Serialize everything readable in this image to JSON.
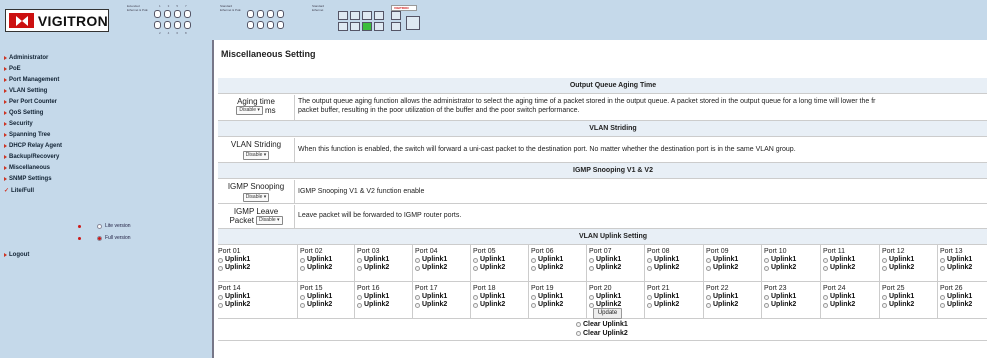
{
  "brand": {
    "name": "VIGITRON",
    "mini_logo": "VIGITRON",
    "accent": "#cc1010",
    "header_bg": "#c5d9ea"
  },
  "panel": {
    "group1_label": "Extended Ethernet & PoE",
    "group2_label": "Standard Ethernet & PoE",
    "group3_label": "Standard Ethernet",
    "group1_top_nums": [
      "1",
      "3",
      "5",
      "7"
    ],
    "group1_bottom_nums": [
      "2",
      "4",
      "6",
      "8"
    ],
    "uplink_label": "Uplink"
  },
  "sidebar": {
    "items": [
      {
        "label": "Administrator"
      },
      {
        "label": "PoE"
      },
      {
        "label": "Port Management"
      },
      {
        "label": "VLAN Setting"
      },
      {
        "label": "Per Port Counter"
      },
      {
        "label": "QoS Setting"
      },
      {
        "label": "Security"
      },
      {
        "label": "Spanning Tree"
      },
      {
        "label": "DHCP Relay Agent"
      },
      {
        "label": "Backup/Recovery"
      },
      {
        "label": "Miscellaneous"
      },
      {
        "label": "SNMP Settings"
      },
      {
        "label": "Lite/Full"
      }
    ],
    "lite_version": "Lite version",
    "full_version": "Full version",
    "logout": "Logout"
  },
  "main": {
    "title": "Miscellaneous Setting",
    "sections": {
      "aging": {
        "header": "Output Queue Aging Time",
        "label": "Aging time",
        "select": "Disable",
        "unit": "ms",
        "desc_line1": "The output queue aging function allows the administrator to select the aging time of a packet stored in the output queue. A packet stored in the output queue for a long time will lower the fr",
        "desc_line2": "packet buffer, resulting in the poor utilization of the buffer and the poor switch performance."
      },
      "striding": {
        "header": "VLAN Striding",
        "label": "VLAN Striding",
        "select": "Disable",
        "desc": "When this function is enabled, the switch will forward a uni-cast packet to the destination port. No matter whether the destination port is in the same VLAN group."
      },
      "igmp": {
        "header": "IGMP Snooping V1 & V2",
        "label": "IGMP Snooping",
        "select": "Disable",
        "desc": "IGMP Snooping V1 & V2 function enable"
      },
      "leave": {
        "label1": "IGMP Leave",
        "label2": "Packet",
        "select": "Disable",
        "desc": "Leave packet will be forwarded to IGMP router ports."
      },
      "uplink": {
        "header": "VLAN Uplink Setting",
        "uplink1": "Uplink1",
        "uplink2": "Uplink2",
        "row1": [
          "Port 01",
          "Port 02",
          "Port 03",
          "Port 04",
          "Port 05",
          "Port 06",
          "Port 07",
          "Port 08",
          "Port 09",
          "Port 10",
          "Port 11",
          "Port 12",
          "Port 13"
        ],
        "row2": [
          "Port 14",
          "Port 15",
          "Port 16",
          "Port 17",
          "Port 18",
          "Port 19",
          "Port 20",
          "Port 21",
          "Port 22",
          "Port 23",
          "Port 24",
          "Port 25",
          "Port 26"
        ],
        "clear1": "Clear Uplink1",
        "clear2": "Clear Uplink2",
        "update": "Update"
      }
    }
  }
}
